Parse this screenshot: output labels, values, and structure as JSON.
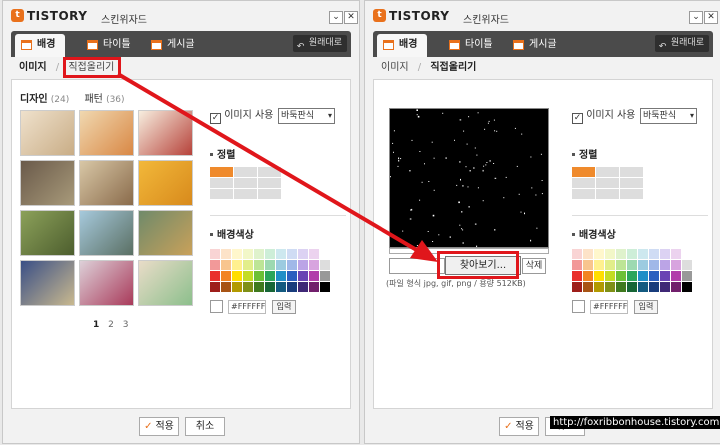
{
  "app": {
    "brand_badge": "t",
    "brand": "TISTORY",
    "title": "스킨위자드",
    "minimize": "⌄",
    "close": "✕"
  },
  "tabs": [
    {
      "label": "배경"
    },
    {
      "label": "타이틀"
    },
    {
      "label": "게시글"
    }
  ],
  "restore_label": "원래대로",
  "subnav": {
    "image": "이미지",
    "sep": "/",
    "upload": "직접올리기"
  },
  "library": {
    "categories": [
      {
        "label": "디자인",
        "count": "(24)"
      },
      {
        "label": "패턴",
        "count": "(36)"
      }
    ],
    "pages": [
      "1",
      "2",
      "3"
    ]
  },
  "image_use": {
    "label": "이미지 사용",
    "checked_mark": "✓",
    "select_value": "바둑판식",
    "arrow": "▾"
  },
  "align": {
    "title": "정렬"
  },
  "bg_color": {
    "title": "배경색상",
    "hex_value": "#FFFFFF",
    "apply_label": "입력",
    "swatches": [
      "#f9d4d4",
      "#fde3c8",
      "#fff7cc",
      "#f2f7c8",
      "#dff2cc",
      "#cdeed8",
      "#cde8ef",
      "#cfdcf4",
      "#dcd2f3",
      "#ecd3ef",
      "#ffffff",
      "#f29999",
      "#f8c58e",
      "#fff08f",
      "#e2ee8a",
      "#bde596",
      "#9dd9b1",
      "#9ccbe0",
      "#a0b8e8",
      "#bba4e6",
      "#d8a4df",
      "#dddddd",
      "#e9302c",
      "#f28422",
      "#ffde00",
      "#c4dc24",
      "#6cc036",
      "#2ba55b",
      "#1f8ec7",
      "#2a5fbf",
      "#6a44b4",
      "#b13eaa",
      "#999999",
      "#9e1e1a",
      "#a85414",
      "#b29a00",
      "#7f9016",
      "#3f7a1e",
      "#176636",
      "#135a80",
      "#183c7c",
      "#3f2876",
      "#711f6c",
      "#000000"
    ]
  },
  "upload": {
    "browse_label": "찾아보기...",
    "delete_label": "삭제",
    "note": "(파일 형식 jpg, gif, png / 용량 512KB)"
  },
  "footer": {
    "apply_mark": "✓",
    "apply_label": "적용",
    "cancel_label": "취소"
  },
  "watermark": "http://foxribbonhouse.tistory.com",
  "colors": {
    "accent": "#e9711c",
    "tab_bar": "#4b4b4b",
    "annotation": "#e0161b"
  }
}
